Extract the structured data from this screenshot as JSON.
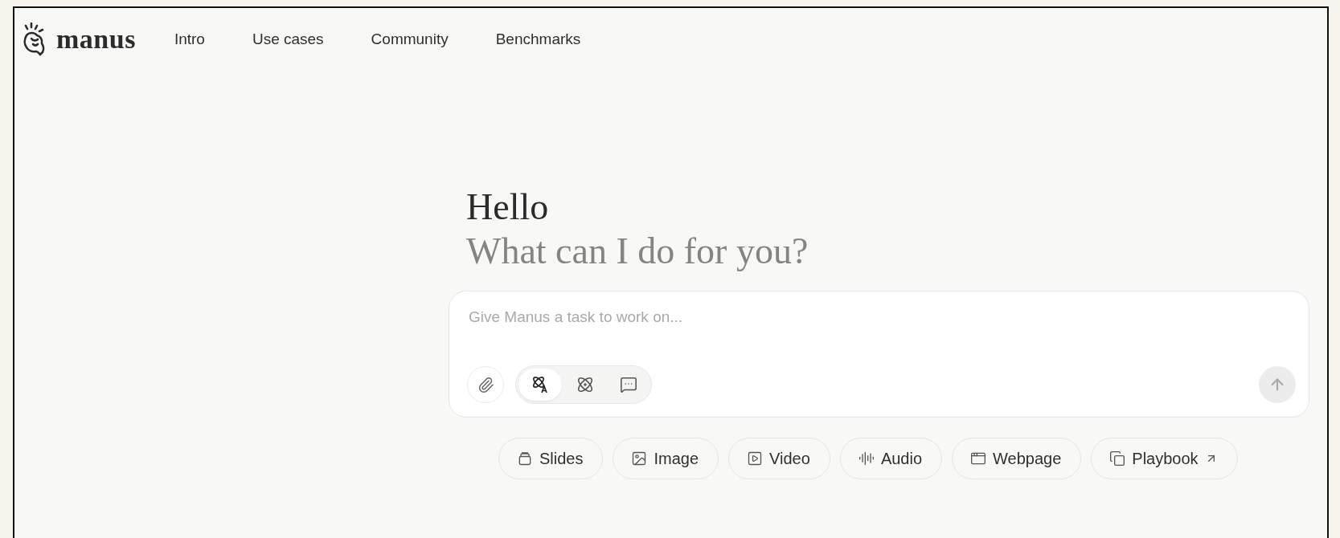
{
  "logo": {
    "text": "manus"
  },
  "nav": [
    {
      "label": "Intro"
    },
    {
      "label": "Use cases"
    },
    {
      "label": "Community"
    },
    {
      "label": "Benchmarks"
    }
  ],
  "greeting": {
    "title": "Hello",
    "subtitle": "What can I do for you?"
  },
  "composer": {
    "placeholder": "Give Manus a task to work on...",
    "modes": [
      {
        "kind": "agent",
        "selected": true
      },
      {
        "kind": "atom",
        "selected": false
      },
      {
        "kind": "chat",
        "selected": false
      }
    ],
    "send_enabled": false
  },
  "chips": [
    {
      "kind": "slides",
      "label": "Slides",
      "external": false
    },
    {
      "kind": "image",
      "label": "Image",
      "external": false
    },
    {
      "kind": "video",
      "label": "Video",
      "external": false
    },
    {
      "kind": "audio",
      "label": "Audio",
      "external": false
    },
    {
      "kind": "webpage",
      "label": "Webpage",
      "external": false
    },
    {
      "kind": "playbook",
      "label": "Playbook",
      "external": true
    }
  ]
}
